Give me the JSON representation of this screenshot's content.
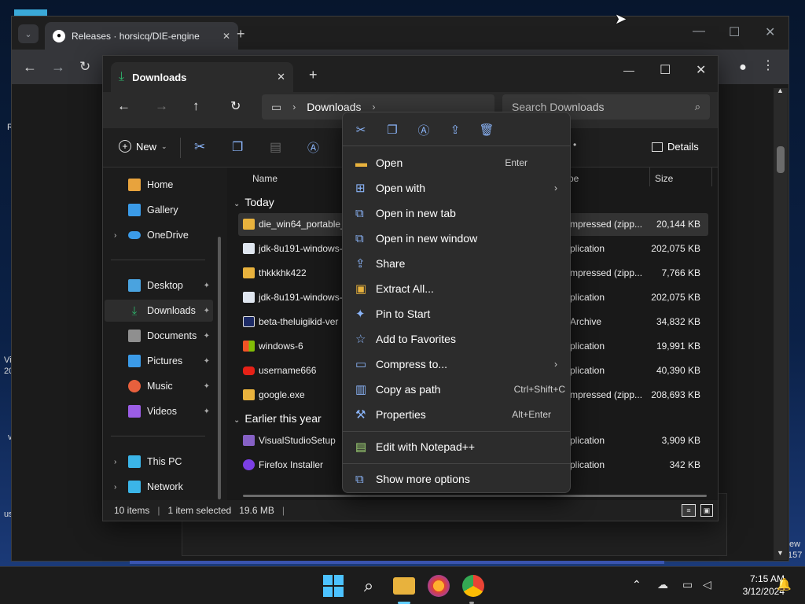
{
  "desktop": {
    "fragments": [
      "R",
      "Vi",
      "20",
      "v",
      "us",
      "ew",
      "157"
    ]
  },
  "chrome": {
    "tab_title": "Releases · horsicq/DIE-engine",
    "new_tab": "+"
  },
  "explorer": {
    "tab_title": "Downloads",
    "new_tab": "+",
    "breadcrumb": [
      "Downloads"
    ],
    "search_placeholder": "Search Downloads",
    "commands": {
      "new_label": "New",
      "details_label": "Details"
    },
    "nav": [
      {
        "label": "Home",
        "icon": "home-icon",
        "color": "#e8a33d",
        "pinned": false,
        "expandable": false
      },
      {
        "label": "Gallery",
        "icon": "gallery-icon",
        "color": "#3b9be8",
        "pinned": false,
        "expandable": false
      },
      {
        "label": "OneDrive",
        "icon": "cloud-icon",
        "color": "#3b9be8",
        "pinned": false,
        "expandable": true
      },
      {
        "label": "Desktop",
        "icon": "desktop-icon",
        "color": "#4aa3df",
        "pinned": true,
        "expandable": false
      },
      {
        "label": "Downloads",
        "icon": "download-icon",
        "color": "#2fb36b",
        "pinned": true,
        "expandable": false,
        "selected": true
      },
      {
        "label": "Documents",
        "icon": "document-icon",
        "color": "#8f8f8f",
        "pinned": true,
        "expandable": false
      },
      {
        "label": "Pictures",
        "icon": "pictures-icon",
        "color": "#3b9be8",
        "pinned": true,
        "expandable": false
      },
      {
        "label": "Music",
        "icon": "music-icon",
        "color": "#e8603d",
        "pinned": true,
        "expandable": false
      },
      {
        "label": "Videos",
        "icon": "videos-icon",
        "color": "#9b5de5",
        "pinned": true,
        "expandable": false
      },
      {
        "label": "This PC",
        "icon": "pc-icon",
        "color": "#3bb5e8",
        "pinned": false,
        "expandable": true
      },
      {
        "label": "Network",
        "icon": "network-icon",
        "color": "#3bb5e8",
        "pinned": false,
        "expandable": true
      }
    ],
    "columns": {
      "name": "Name",
      "type": "pe",
      "size": "Size"
    },
    "groups": {
      "today": "Today",
      "earlier": "Earlier this year"
    },
    "files_today": [
      {
        "name": "die_win64_portable_",
        "type": "mpressed (zipp...",
        "size": "20,144 KB",
        "icon": "zip-folder-icon",
        "selected": true
      },
      {
        "name": "jdk-8u191-windows-",
        "type": "plication",
        "size": "202,075 KB",
        "icon": "java-icon"
      },
      {
        "name": "thkkkhk422",
        "type": "mpressed (zipp...",
        "size": "7,766 KB",
        "icon": "zip-folder-icon"
      },
      {
        "name": "jdk-8u191-windows-",
        "type": "plication",
        "size": "202,075 KB",
        "icon": "java-icon"
      },
      {
        "name": "beta-theluigikid-ver",
        "type": "Archive",
        "size": "34,832 KB",
        "icon": "archive-icon"
      },
      {
        "name": "windows-6",
        "type": "plication",
        "size": "19,991 KB",
        "icon": "windows-icon"
      },
      {
        "name": "username666",
        "type": "plication",
        "size": "40,390 KB",
        "icon": "youtube-icon"
      },
      {
        "name": "google.exe",
        "type": "mpressed (zipp...",
        "size": "208,693 KB",
        "icon": "zip-folder-icon"
      }
    ],
    "files_earlier": [
      {
        "name": "VisualStudioSetup",
        "type": "plication",
        "size": "3,909 KB",
        "icon": "visualstudio-icon"
      },
      {
        "name": "Firefox Installer",
        "type": "plication",
        "size": "342 KB",
        "icon": "firefox-icon"
      }
    ],
    "status": {
      "count": "10 items",
      "selected": "1 item selected",
      "size": "19.6 MB"
    }
  },
  "context_menu": {
    "items": [
      {
        "label": "Open",
        "shortcut": "Enter",
        "icon": "folder-open-icon",
        "submenu": false
      },
      {
        "label": "Open with",
        "shortcut": "",
        "icon": "open-with-icon",
        "submenu": true
      },
      {
        "label": "Open in new tab",
        "shortcut": "",
        "icon": "new-tab-icon",
        "submenu": false
      },
      {
        "label": "Open in new window",
        "shortcut": "",
        "icon": "new-window-icon",
        "submenu": false
      },
      {
        "label": "Share",
        "shortcut": "",
        "icon": "share-icon",
        "submenu": false
      },
      {
        "label": "Extract All...",
        "shortcut": "",
        "icon": "extract-icon",
        "submenu": false
      },
      {
        "label": "Pin to Start",
        "shortcut": "",
        "icon": "pin-icon",
        "submenu": false
      },
      {
        "label": "Add to Favorites",
        "shortcut": "",
        "icon": "star-icon",
        "submenu": false
      },
      {
        "label": "Compress to...",
        "shortcut": "",
        "icon": "compress-icon",
        "submenu": true
      },
      {
        "label": "Copy as path",
        "shortcut": "Ctrl+Shift+C",
        "icon": "copy-path-icon",
        "submenu": false
      },
      {
        "label": "Properties",
        "shortcut": "Alt+Enter",
        "icon": "properties-icon",
        "submenu": false
      }
    ],
    "extra": {
      "label": "Edit with Notepad++",
      "icon": "notepadpp-icon"
    },
    "more": {
      "label": "Show more options",
      "icon": "more-options-icon"
    }
  },
  "taskbar": {
    "time": "7:15 AM",
    "date": "3/12/2024"
  },
  "colors": {
    "accent": "#8ab4f8",
    "folder": "#e8b23d",
    "selection": "#333333"
  }
}
